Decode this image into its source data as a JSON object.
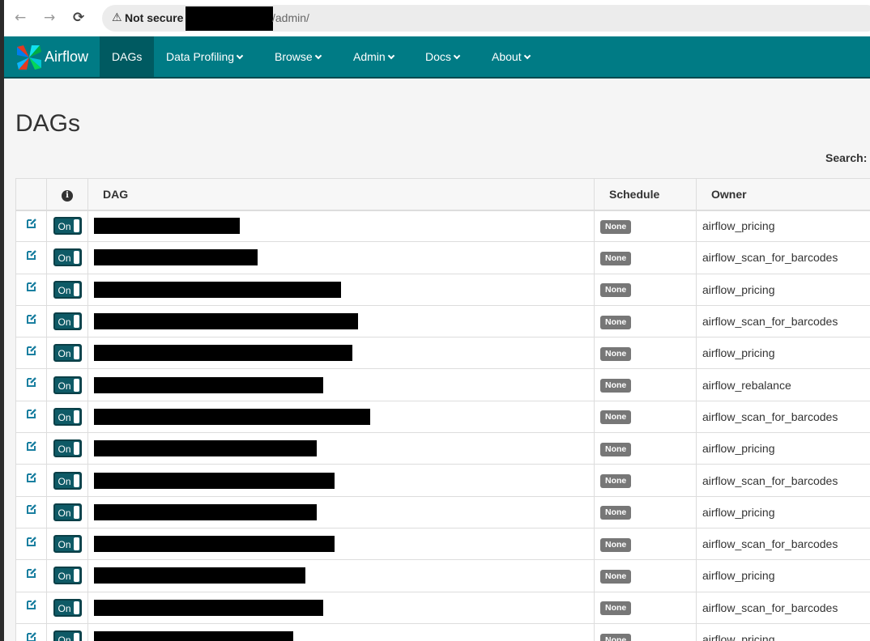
{
  "browser": {
    "back": "←",
    "forward": "→",
    "reload": "⟳",
    "security_warning_icon": "⚠",
    "not_secure": "Not secure",
    "url_path": "/admin/"
  },
  "navbar": {
    "brand": "Airflow",
    "items": [
      {
        "label": "DAGs",
        "active": true,
        "dropdown": false
      },
      {
        "label": "Data Profiling",
        "dropdown": true
      },
      {
        "label": "Browse",
        "dropdown": true
      },
      {
        "label": "Admin",
        "dropdown": true
      },
      {
        "label": "Docs",
        "dropdown": true
      },
      {
        "label": "About",
        "dropdown": true
      }
    ]
  },
  "page": {
    "title": "DAGs",
    "search_label": "Search:"
  },
  "table": {
    "headers": {
      "info": "i",
      "dag": "DAG",
      "schedule": "Schedule",
      "owner": "Owner"
    },
    "rows": [
      {
        "toggle": "On",
        "schedule": "None",
        "owner": "airflow_pricing"
      },
      {
        "toggle": "On",
        "schedule": "None",
        "owner": "airflow_scan_for_barcodes"
      },
      {
        "toggle": "On",
        "schedule": "None",
        "owner": "airflow_pricing"
      },
      {
        "toggle": "On",
        "schedule": "None",
        "owner": "airflow_scan_for_barcodes"
      },
      {
        "toggle": "On",
        "schedule": "None",
        "owner": "airflow_pricing"
      },
      {
        "toggle": "On",
        "schedule": "None",
        "owner": "airflow_rebalance"
      },
      {
        "toggle": "On",
        "schedule": "None",
        "owner": "airflow_scan_for_barcodes"
      },
      {
        "toggle": "On",
        "schedule": "None",
        "owner": "airflow_pricing"
      },
      {
        "toggle": "On",
        "schedule": "None",
        "owner": "airflow_scan_for_barcodes"
      },
      {
        "toggle": "On",
        "schedule": "None",
        "owner": "airflow_pricing"
      },
      {
        "toggle": "On",
        "schedule": "None",
        "owner": "airflow_scan_for_barcodes"
      },
      {
        "toggle": "On",
        "schedule": "None",
        "owner": "airflow_pricing"
      },
      {
        "toggle": "On",
        "schedule": "None",
        "owner": "airflow_scan_for_barcodes"
      },
      {
        "toggle": "On",
        "schedule": "None",
        "owner": "airflow_pricing"
      }
    ]
  },
  "colors": {
    "navbar": "#007b85",
    "navbar_active": "#005a61",
    "toggle_on": "#0e5a66",
    "badge": "#777777"
  }
}
